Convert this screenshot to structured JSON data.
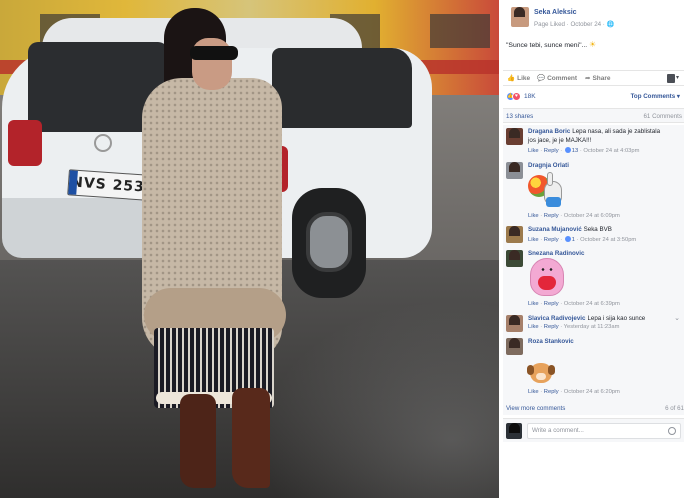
{
  "post": {
    "author": "Seka Aleksic",
    "meta": "Page Liked · October 24 · 🌐",
    "text": "\"Sunce tebi, sunce meni\"...",
    "sun_glyph": "☀"
  },
  "photo": {
    "plate": "NVS 253"
  },
  "actions": {
    "like": "Like",
    "comment": "Comment",
    "share": "Share",
    "like_icon": "like-icon",
    "comment_icon": "comment-icon",
    "share_icon": "share-icon"
  },
  "reactions": {
    "count": "18K",
    "sort_label": "Top Comments ▾"
  },
  "stats": {
    "shares": "13 shares",
    "comments": "61 Comments"
  },
  "comments": [
    {
      "name": "Dragana Boric",
      "text": "Lepa nasa, ali sada je zablistala",
      "text2": "jos jace, je je MAJKA!!!",
      "like": "Like",
      "reply": "Reply",
      "reacts": "13",
      "time": "October 24 at 4:03pm"
    },
    {
      "name": "Dragnja Orlati",
      "text": "",
      "like": "Like",
      "reply": "Reply",
      "time": "October 24 at 6:09pm"
    },
    {
      "name": "Suzana Mujanović",
      "text": "Seka BVB",
      "like": "Like",
      "reply": "Reply",
      "reacts": "1",
      "time": "October 24 at 3:50pm"
    },
    {
      "name": "Snezana Radinovic",
      "text": "",
      "like": "Like",
      "reply": "Reply",
      "time": "October 24 at 6:39pm"
    },
    {
      "name": "Slavica Radivojevic",
      "text": "Lepa i sija kao sunce",
      "like": "Like",
      "reply": "Reply",
      "time": "Yesterday at 11:23am"
    },
    {
      "name": "Roza Stankovic",
      "text": "",
      "like": "Like",
      "reply": "Reply",
      "time": "October 24 at 6:20pm"
    }
  ],
  "footer": {
    "view_more": "View more comments",
    "count_of": "6 of 61",
    "placeholder": "Write a comment..."
  },
  "colors": {
    "link": "#365899",
    "muted": "#90949c",
    "like_blue": "#5890ff",
    "love_red": "#f25268"
  }
}
